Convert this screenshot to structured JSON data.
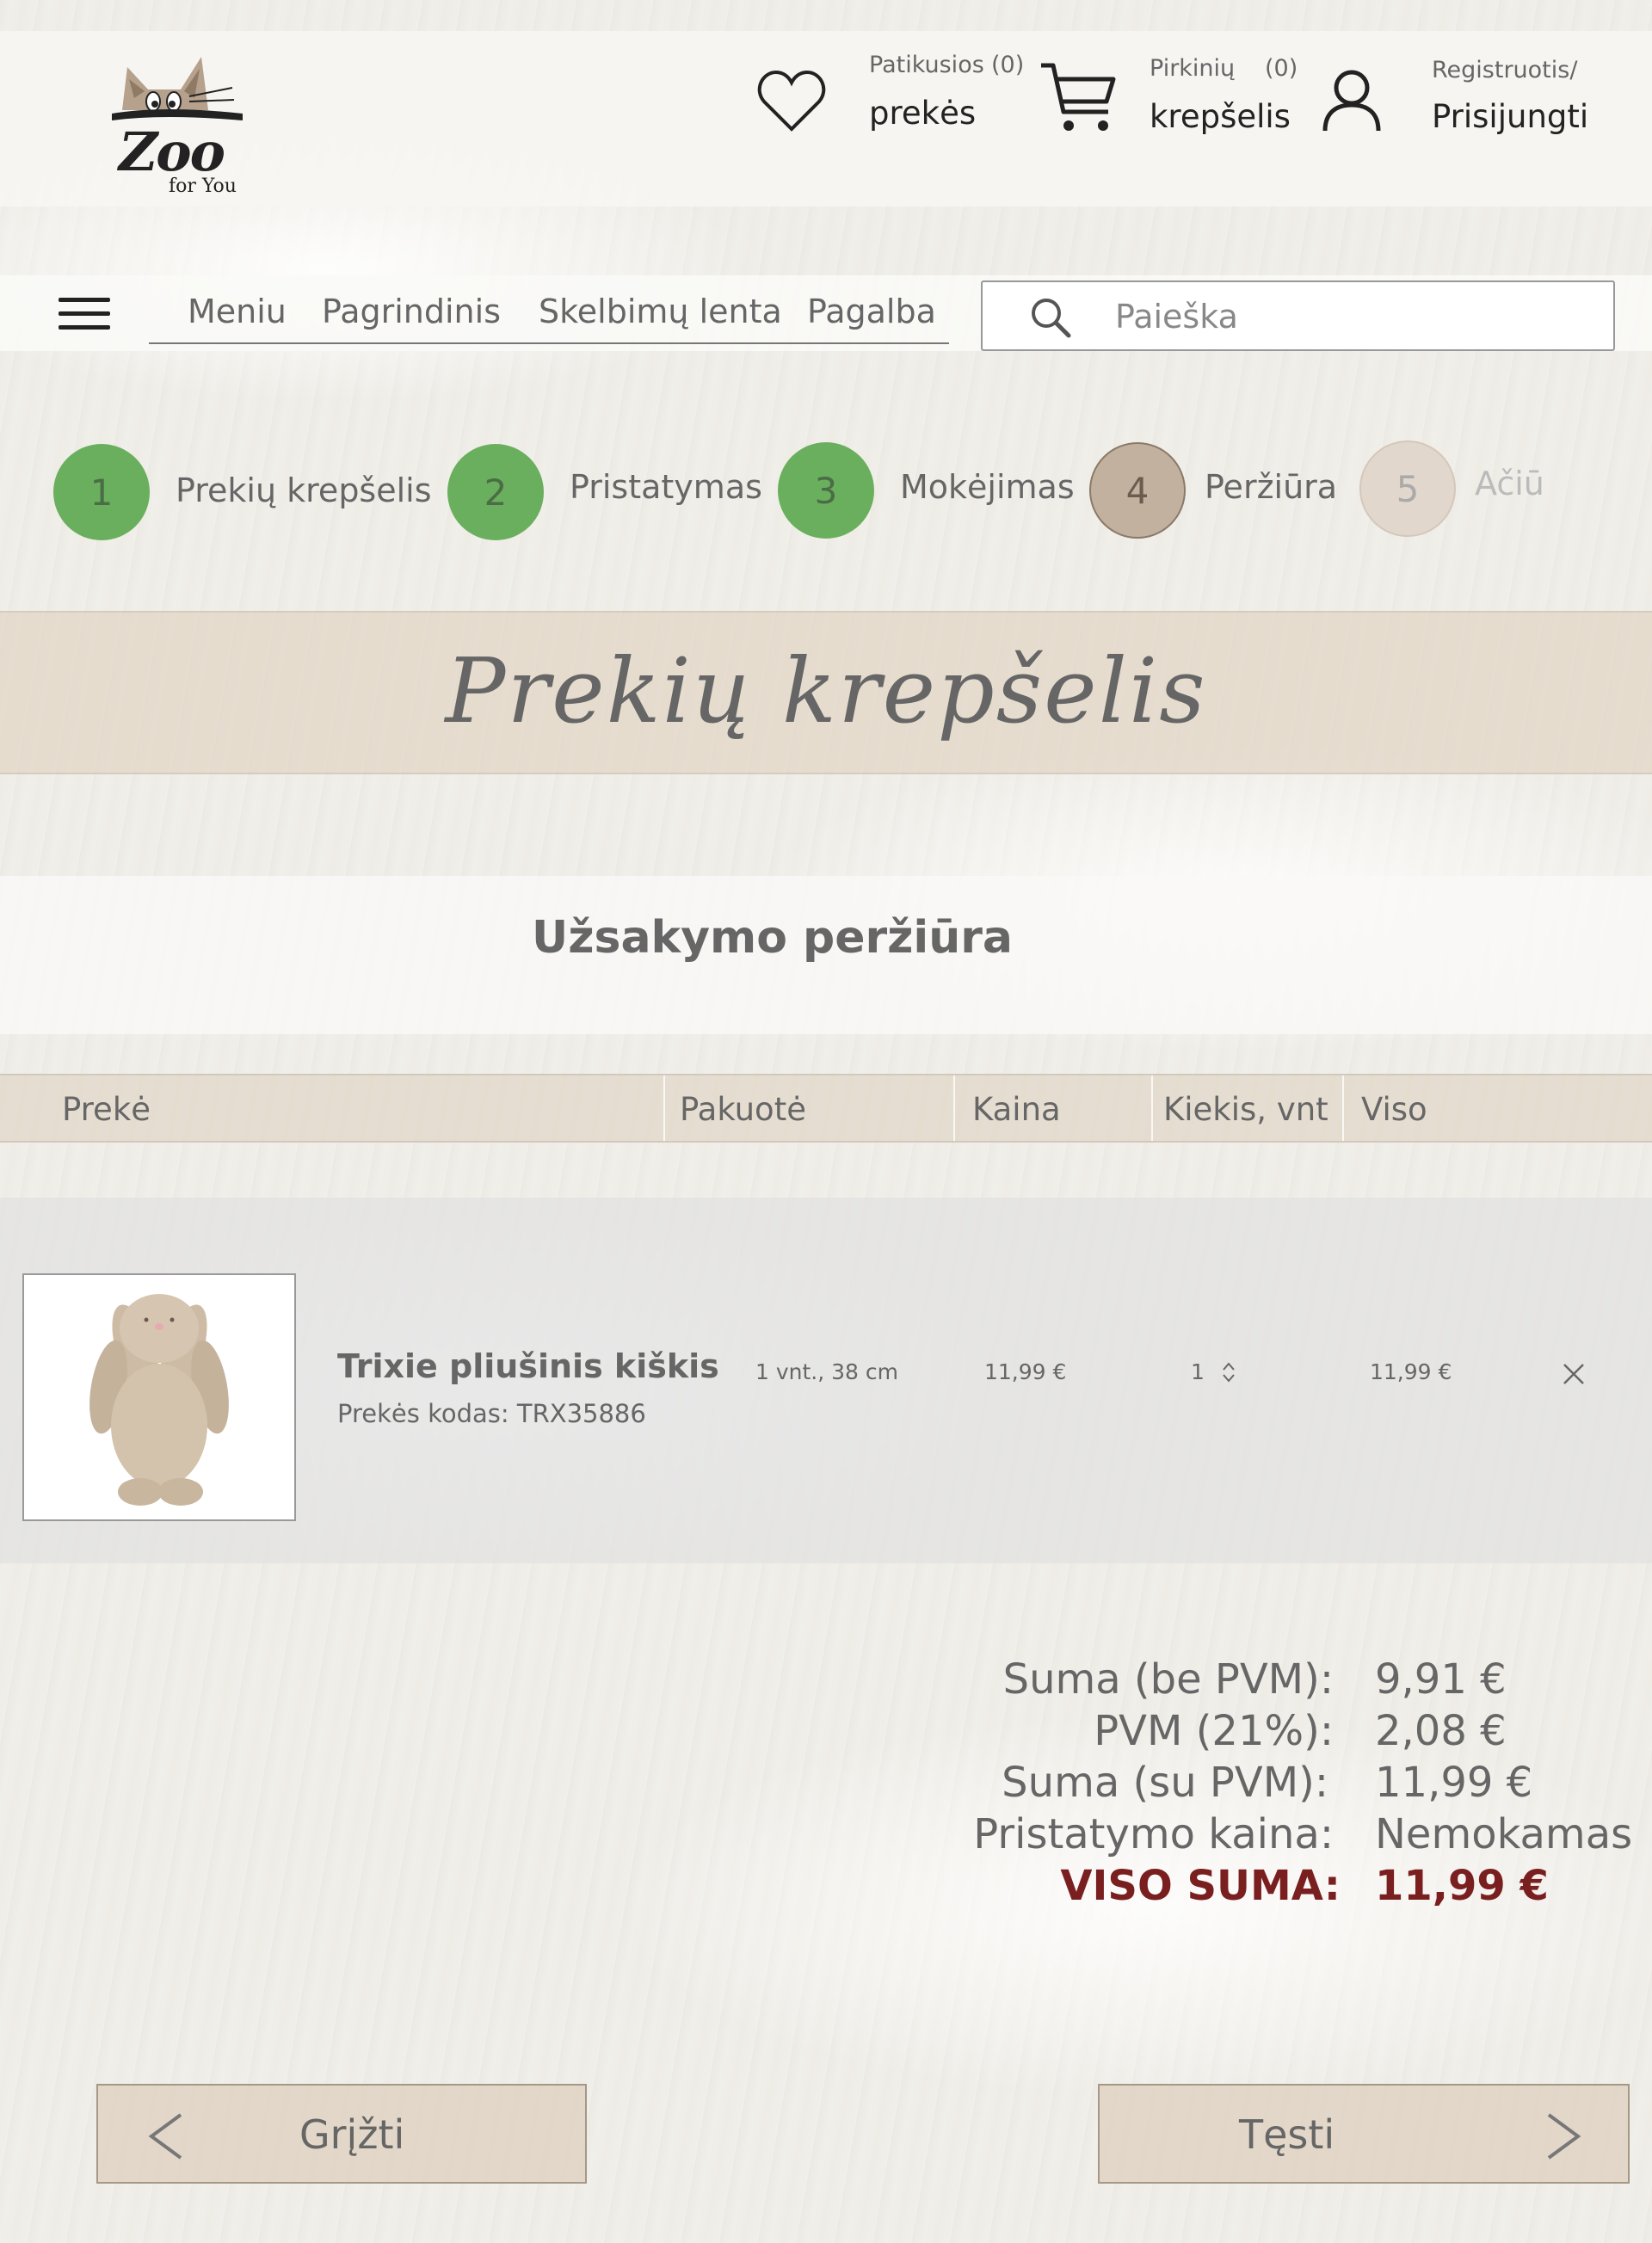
{
  "header": {
    "favorites_small": "Patikusios",
    "favorites_count": "(0)",
    "favorites_big": "prekės",
    "cart_small": "Pirkinių",
    "cart_count": "(0)",
    "cart_big": "krepšelis",
    "account_small": "Registruotis/",
    "account_big": "Prisijungti"
  },
  "logo": {
    "main": "Zoo",
    "sub": "for You"
  },
  "nav": {
    "items": [
      {
        "label": "Meniu"
      },
      {
        "label": "Pagrindinis"
      },
      {
        "label": "Skelbimų lenta"
      },
      {
        "label": "Pagalba"
      }
    ],
    "search_placeholder": "Paieška"
  },
  "steps": [
    {
      "num": "1",
      "label": "Prekių krepšelis",
      "state": "done"
    },
    {
      "num": "2",
      "label": "Pristatymas",
      "state": "done"
    },
    {
      "num": "3",
      "label": "Mokėjimas",
      "state": "done"
    },
    {
      "num": "4",
      "label": "Peržiūra",
      "state": "current"
    },
    {
      "num": "5",
      "label": "Ačiū",
      "state": "upcoming"
    }
  ],
  "page_title": "Prekių krepšelis",
  "section_title": "Užsakymo peržiūra",
  "table": {
    "headers": [
      "Prekė",
      "Pakuotė",
      "Kaina",
      "Kiekis, vnt",
      "Viso"
    ],
    "rows": [
      {
        "name": "Trixie pliušinis kiškis",
        "code": "Prekės kodas: TRX35886",
        "package": "1 vnt., 38 cm",
        "price": "11,99 €",
        "quantity": "1",
        "total": "11,99 €"
      }
    ]
  },
  "totals": {
    "subtotal_label": "Suma (be PVM):",
    "subtotal_value": "9,91 €",
    "vat_label": "PVM (21%):",
    "vat_value": "2,08 €",
    "with_vat_label": "Suma (su PVM):",
    "with_vat_value": "11,99 €",
    "delivery_label": "Pristatymo kaina:",
    "delivery_value": "Nemokamas",
    "grand_label": "VISO SUMA:",
    "grand_value": "11,99 €"
  },
  "buttons": {
    "back": "Grįžti",
    "next": "Tęsti"
  },
  "colors": {
    "step_done": "#6aaf5e",
    "step_current": "#c2b19f",
    "step_upcoming": "#e2d7cc",
    "grand_total": "#7a1f1f",
    "accent_band": "#e1d5c6"
  }
}
